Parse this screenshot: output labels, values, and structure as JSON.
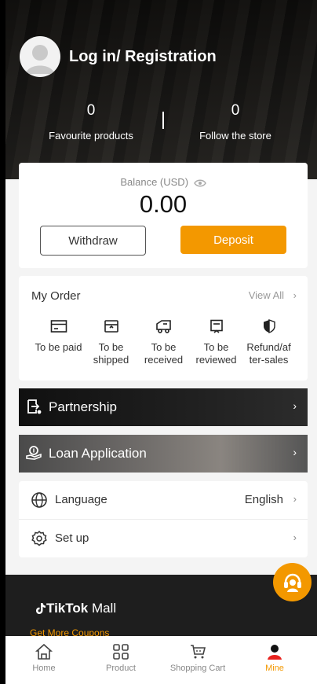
{
  "header": {
    "login_text": "Log in/ Registration",
    "stats": [
      {
        "value": "0",
        "label": "Favourite products"
      },
      {
        "value": "0",
        "label": "Follow the store"
      }
    ]
  },
  "balance": {
    "label": "Balance  (USD)",
    "value": "0.00",
    "withdraw_label": "Withdraw",
    "deposit_label": "Deposit"
  },
  "orders": {
    "title": "My Order",
    "view_all": "View All",
    "items": [
      {
        "label": "To be paid",
        "icon": "card-icon"
      },
      {
        "label": "To be shipped",
        "icon": "box-icon"
      },
      {
        "label": "To be received",
        "icon": "truck-icon"
      },
      {
        "label": "To be reviewed",
        "icon": "review-icon"
      },
      {
        "label": "Refund/af ter-sales",
        "icon": "shield-icon"
      }
    ]
  },
  "banners": [
    {
      "label": "Partnership",
      "icon": "partnership-icon"
    },
    {
      "label": "Loan Application",
      "icon": "loan-icon"
    }
  ],
  "settings": [
    {
      "label": "Language",
      "value": "English",
      "icon": "globe-icon"
    },
    {
      "label": "Set up",
      "value": "",
      "icon": "gear-icon"
    }
  ],
  "footer": {
    "brand_tiktok": "TikTok",
    "brand_mall": " Mall",
    "coupons": "Get More Coupons"
  },
  "tabs": [
    {
      "label": "Home",
      "icon": "home-icon",
      "active": false
    },
    {
      "label": "Product",
      "icon": "grid-icon",
      "active": false
    },
    {
      "label": "Shopping Cart",
      "icon": "cart-icon",
      "active": false
    },
    {
      "label": "Mine",
      "icon": "user-icon",
      "active": true
    }
  ],
  "colors": {
    "accent": "#f39800",
    "dark": "#1e1e1e"
  }
}
